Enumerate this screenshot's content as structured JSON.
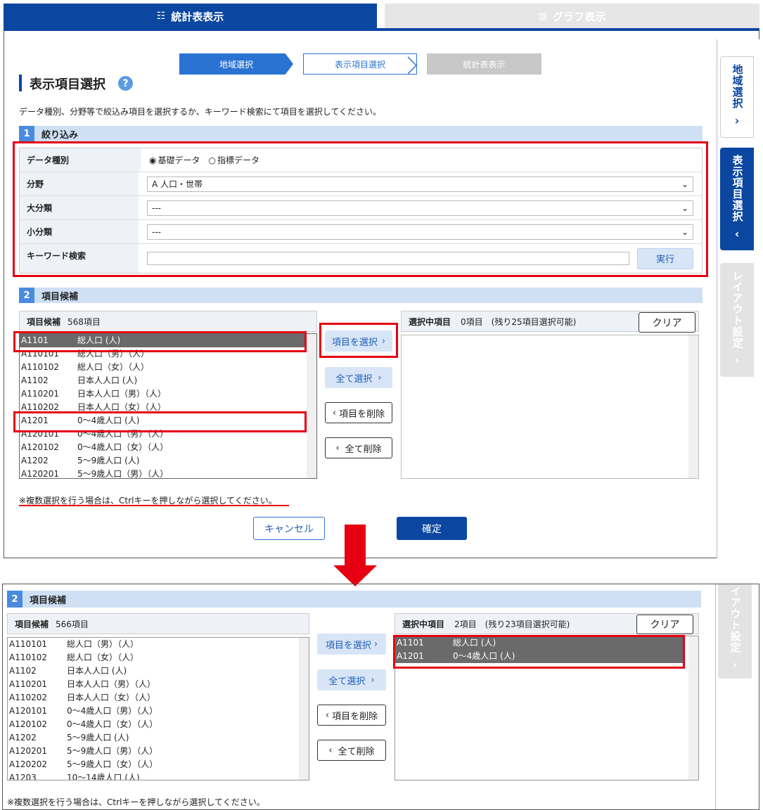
{
  "tabs": {
    "stats": "統計表表示",
    "graph": "グラフ表示"
  },
  "steps": [
    "地域選択",
    "表示項目選択",
    "統計表表示"
  ],
  "page": {
    "title": "表示項目選択",
    "help_icon": "?",
    "instruction": "データ種別、分野等で絞込み項目を選択するか、キーワード検索にて項目を選択してください。"
  },
  "side_tabs": [
    {
      "label": "地域選択",
      "chevron": "›"
    },
    {
      "label": "表示項目選択",
      "chevron": "‹"
    },
    {
      "label": "レイアウト設定",
      "chevron": "›"
    }
  ],
  "filter": {
    "num": "1",
    "title": "絞り込み",
    "data_type_label": "データ種別",
    "radio_basic": "基礎データ",
    "radio_index": "指標データ",
    "field_label": "分野",
    "field_value": "A 人口・世帯",
    "major_label": "大分類",
    "major_value": "---",
    "minor_label": "小分類",
    "minor_value": "---",
    "keyword_label": "キーワード検索",
    "keyword_value": "",
    "run_button": "実行"
  },
  "candidates": {
    "num": "2",
    "title": "項目候補",
    "list_title": "項目候補",
    "count_before": "568項目",
    "selected_title": "選択中項目",
    "selected_count_before": "0項目　(残り25項目選択可能)",
    "clear": "クリア",
    "items_before": [
      {
        "code": "A1101",
        "name": "総人口 (人)"
      },
      {
        "code": "A110101",
        "name": "総人口（男）（人）"
      },
      {
        "code": "A110102",
        "name": "総人口（女）（人）"
      },
      {
        "code": "A1102",
        "name": "日本人人口 (人)"
      },
      {
        "code": "A110201",
        "name": "日本人人口（男）（人）"
      },
      {
        "code": "A110202",
        "name": "日本人人口（女）（人）"
      },
      {
        "code": "A1201",
        "name": "0～4歳人口 (人)"
      },
      {
        "code": "A120101",
        "name": "0～4歳人口（男）（人）"
      },
      {
        "code": "A120102",
        "name": "0～4歳人口（女）（人）"
      },
      {
        "code": "A1202",
        "name": "5～9歳人口 (人)"
      },
      {
        "code": "A120201",
        "name": "5～9歳人口（男）（人）"
      }
    ]
  },
  "buttons": {
    "select_item": "項目を選択",
    "select_all": "全て選択",
    "delete_item": "項目を削除",
    "delete_all": "全て削除",
    "cancel": "キャンセル",
    "confirm": "確定"
  },
  "note": "※複数選択を行う場合は、Ctrlキーを押しながら選択してください。",
  "after": {
    "num": "2",
    "title": "項目候補",
    "list_title": "項目候補",
    "count": "566項目",
    "selected_title": "選択中項目",
    "selected_count": "2項目　(残り23項目選択可能)",
    "clear": "クリア",
    "items": [
      {
        "code": "A110101",
        "name": "総人口（男）（人）"
      },
      {
        "code": "A110102",
        "name": "総人口（女）（人）"
      },
      {
        "code": "A1102",
        "name": "日本人人口 (人)"
      },
      {
        "code": "A110201",
        "name": "日本人人口（男）（人）"
      },
      {
        "code": "A110202",
        "name": "日本人人口（女）（人）"
      },
      {
        "code": "A120101",
        "name": "0～4歳人口（男）（人）"
      },
      {
        "code": "A120102",
        "name": "0～4歳人口（女）（人）"
      },
      {
        "code": "A1202",
        "name": "5～9歳人口 (人)"
      },
      {
        "code": "A120201",
        "name": "5～9歳人口（男）（人）"
      },
      {
        "code": "A120202",
        "name": "5～9歳人口（女）（人）"
      },
      {
        "code": "A1203",
        "name": "10～14歳人口 (人)"
      }
    ],
    "selected_items": [
      {
        "code": "A1101",
        "name": "総人口 (人)"
      },
      {
        "code": "A1201",
        "name": "0～4歳人口 (人)"
      }
    ],
    "side_label": "イアウト設定",
    "side_chevron": "›"
  },
  "colors": {
    "accent": "#0b47a1",
    "step_active": "#2b73d2",
    "highlight": "#e60012",
    "selected_row": "#6a6a6a"
  },
  "icons": {
    "table_tab": "list-icon",
    "graph_tab": "bar-chart-icon",
    "down_arrow": "arrow-down-icon"
  }
}
